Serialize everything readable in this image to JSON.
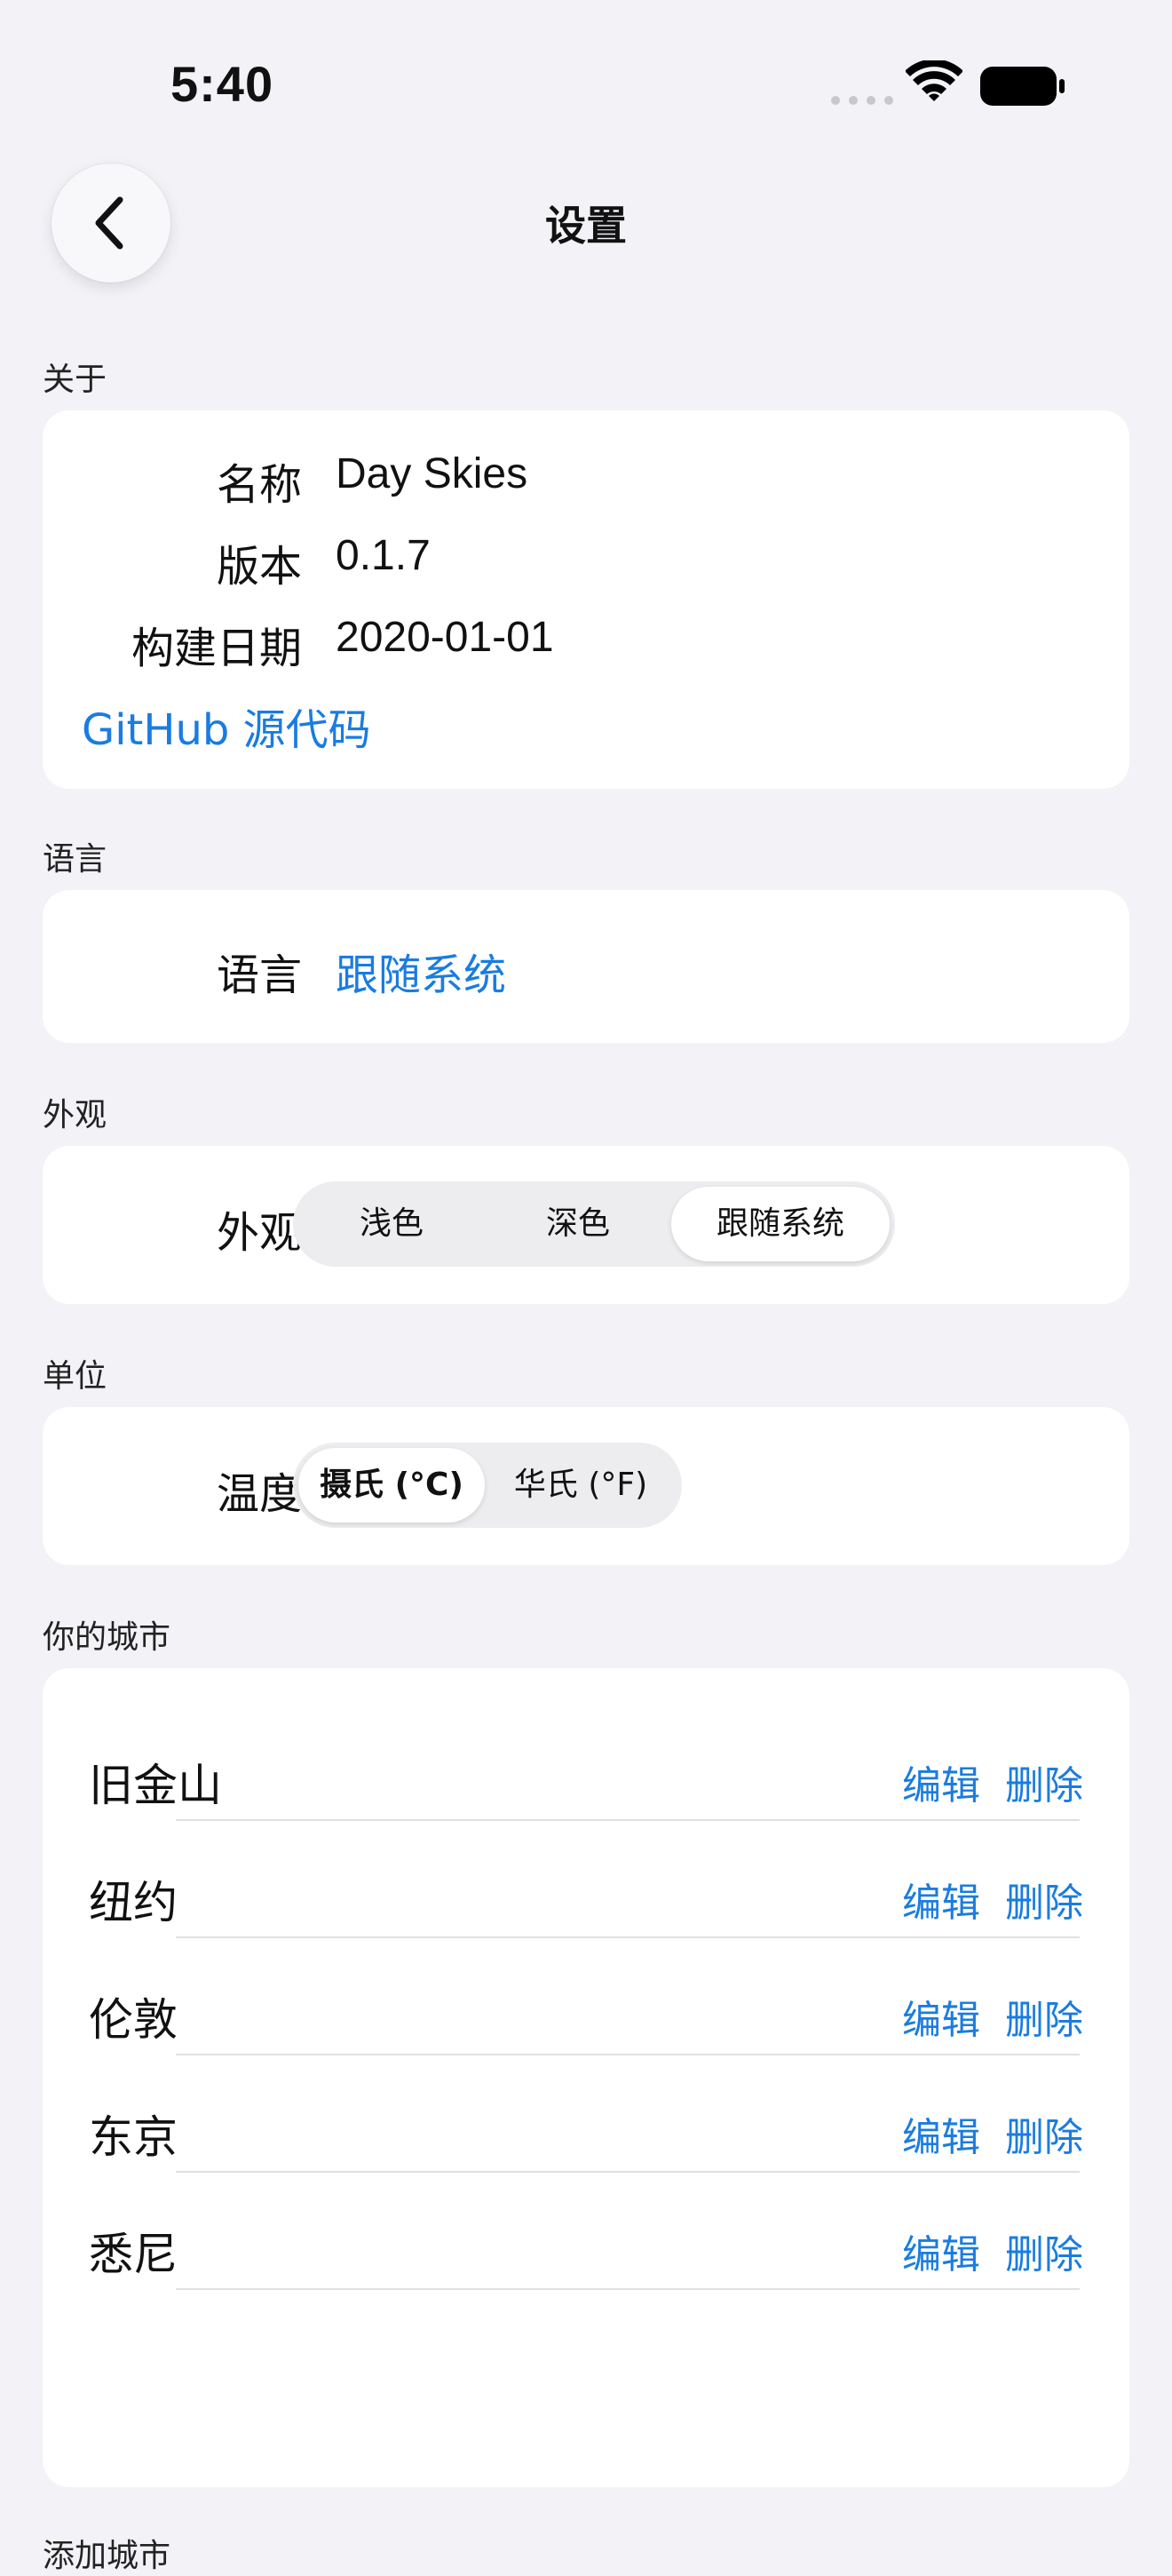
{
  "status_bar": {
    "time": "5:40"
  },
  "nav": {
    "title": "设置"
  },
  "sections": {
    "about": "关于",
    "language": "语言",
    "appearance": "外观",
    "units": "单位",
    "cities": "你的城市",
    "add_city": "添加城市"
  },
  "about": {
    "name_label": "名称",
    "name_value": "Day Skies",
    "version_label": "版本",
    "version_value": "0.1.7",
    "build_label": "构建日期",
    "build_value": "2020-01-01",
    "github_link": "GitHub 源代码"
  },
  "language": {
    "label": "语言",
    "value": "跟随系统"
  },
  "appearance": {
    "label": "外观",
    "options": [
      "浅色",
      "深色",
      "跟随系统"
    ],
    "selected": "跟随系统"
  },
  "units": {
    "label": "温度",
    "options": [
      "摄氏 (°C)",
      "华氏 (°F)"
    ],
    "selected": "摄氏 (°C)"
  },
  "cities": {
    "edit_label": "编辑",
    "delete_label": "删除",
    "items": [
      "旧金山",
      "纽约",
      "伦敦",
      "东京",
      "悉尼"
    ]
  },
  "colors": {
    "background": "#F2F2F7",
    "card": "#FFFFFF",
    "accent": "#1A7CE0"
  }
}
